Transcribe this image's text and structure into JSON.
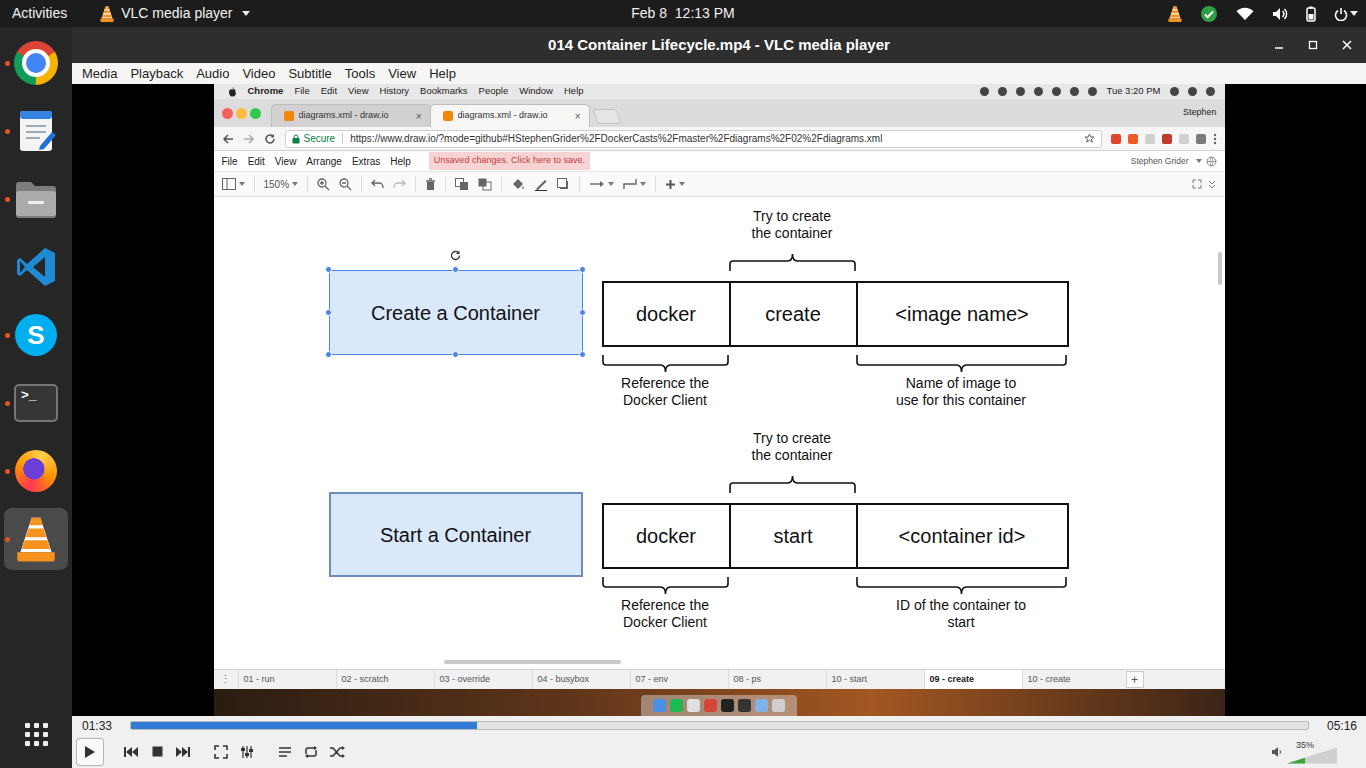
{
  "topbar": {
    "activities": "Activities",
    "app": "VLC media player",
    "clock": "Feb 8  12:13 PM"
  },
  "dock": {
    "items": [
      {
        "kind": "chrome",
        "running": true,
        "selected": false
      },
      {
        "kind": "editor",
        "running": true,
        "selected": false
      },
      {
        "kind": "files",
        "running": true,
        "selected": false
      },
      {
        "kind": "vscode",
        "running": false,
        "selected": false
      },
      {
        "kind": "skype",
        "running": true,
        "selected": false,
        "glyph": "S"
      },
      {
        "kind": "terminal",
        "running": true,
        "selected": false,
        "glyph": ">_"
      },
      {
        "kind": "firefox",
        "running": true,
        "selected": false
      },
      {
        "kind": "vlc",
        "running": true,
        "selected": true
      }
    ]
  },
  "window": {
    "title": "014 Container Lifecycle.mp4 - VLC media player"
  },
  "menu": [
    "Media",
    "Playback",
    "Audio",
    "Video",
    "Subtitle",
    "Tools",
    "View",
    "Help"
  ],
  "screen": {
    "menubar": {
      "items": [
        "Chrome",
        "File",
        "Edit",
        "View",
        "History",
        "Bookmarks",
        "People",
        "Window",
        "Help"
      ],
      "clock": "Tue 3:20 PM"
    },
    "user": "Stephen",
    "close_glyph": "×",
    "tabs": [
      {
        "label": "diagrams.xml - draw.io",
        "selected": false
      },
      {
        "label": "diagrams.xml - draw.io",
        "selected": true
      }
    ],
    "secure": "Secure",
    "url": "https://www.draw.io/?mode=github#HStephenGrider%2FDockerCasts%2Fmaster%2Fdiagrams%2F02%2Fdiagrams.xml",
    "app_menu": [
      "File",
      "Edit",
      "View",
      "Arrange",
      "Extras",
      "Help"
    ],
    "notice": "Unsaved changes. Click here to save.",
    "account": "Stephen Grider",
    "zoom": "150%",
    "diagram": {
      "rows": [
        {
          "title": "Create a Container",
          "selected": true,
          "cells": [
            "docker",
            "create",
            "<image name>"
          ],
          "above": [
            "Try to create",
            "the container"
          ],
          "below": [
            [
              "Reference the",
              "Docker Client"
            ],
            [
              "Name of image to",
              "use for this container"
            ]
          ]
        },
        {
          "title": "Start a Container",
          "selected": false,
          "cells": [
            "docker",
            "start",
            "<container id>"
          ],
          "above": [
            "Try to create",
            "the container"
          ],
          "below": [
            [
              "Reference the",
              "Docker Client"
            ],
            [
              "ID of the container to",
              "start"
            ]
          ]
        }
      ]
    },
    "menu_glyph": "⋮",
    "pages": [
      {
        "label": "01 - run",
        "selected": false
      },
      {
        "label": "02 - scratch",
        "selected": false
      },
      {
        "label": "03 - override",
        "selected": false
      },
      {
        "label": "04 - busybox",
        "selected": false
      },
      {
        "label": "07 - env",
        "selected": false
      },
      {
        "label": "08 - ps",
        "selected": false
      },
      {
        "label": "10 - start",
        "selected": false
      },
      {
        "label": "09 - create",
        "selected": true
      },
      {
        "label": "10 - create",
        "selected": false
      }
    ],
    "add_page": "+"
  },
  "player": {
    "elapsed": "01:33",
    "total": "05:16",
    "level": 0.294,
    "volume": {
      "reading": "35%",
      "level": 0.35
    }
  }
}
